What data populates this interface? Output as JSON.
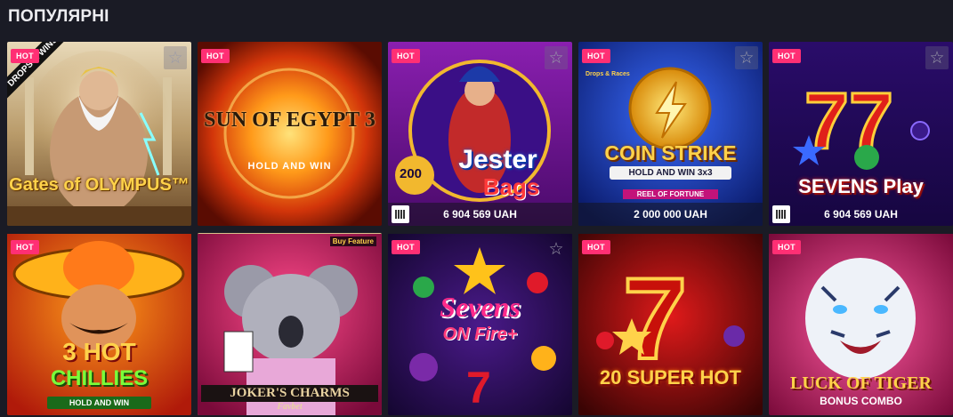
{
  "section": {
    "title": "ПОПУЛЯРНІ"
  },
  "badges": {
    "hot": "HOT"
  },
  "games": [
    {
      "name": "Gates of Olympus",
      "hot": true,
      "logo_text": "Gates of OLYMPUS™",
      "ribbon": "DROPS & WINS",
      "favorite": false
    },
    {
      "name": "Sun of Egypt 3",
      "hot": true,
      "logo_line1": "SUN OF EGYPT 3",
      "logo_line2": "HOLD AND WIN",
      "favorite": false
    },
    {
      "name": "Jester Bags",
      "hot": true,
      "logo_line1": "Jester",
      "logo_line2": "Bags",
      "multiplier": "200",
      "jackpot": "6 904 569 UAH",
      "favorite": false
    },
    {
      "name": "Coin Strike",
      "hot": true,
      "logo_line1": "COIN STRIKE",
      "logo_line2": "HOLD AND WIN 3x3",
      "sub_label": "REEL OF FORTUNE",
      "jackpot": "2 000 000 UAH",
      "top_badge": "Drops & Races",
      "favorite": false
    },
    {
      "name": "Sevens Play",
      "hot": true,
      "logo_text": "SEVENS Play",
      "jackpot": "6 904 569 UAH",
      "favorite": false
    },
    {
      "name": "3 Hot Chillies",
      "hot": true,
      "logo_line1": "3 HOT",
      "logo_line2": "CHILLIES",
      "logo_line3": "HOLD AND WIN",
      "favorite": false
    },
    {
      "name": "Joker's Charms",
      "hot": false,
      "logo_line1": "JOKER'S CHARMS",
      "logo_line2": "Favbet",
      "corner_badge": "Buy Feature",
      "favorite": false
    },
    {
      "name": "Sevens on Fire+",
      "hot": true,
      "logo_line1": "Sevens",
      "logo_line2": "ON Fire+",
      "favorite": false
    },
    {
      "name": "20 Super Hot",
      "hot": true,
      "logo_text": "20 SUPER HOT",
      "favorite": false
    },
    {
      "name": "Luck of Tiger",
      "hot": true,
      "logo_line1": "LUCK OF TIGER",
      "logo_line2": "BONUS COMBO",
      "favorite": false
    }
  ],
  "colors": {
    "background": "#1a1b25",
    "hot_badge": "#ff2f74"
  }
}
